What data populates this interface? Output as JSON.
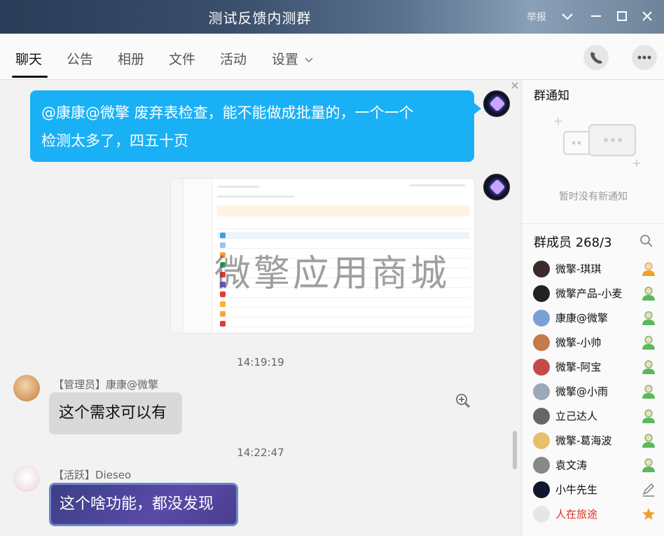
{
  "window": {
    "title": "测试反馈内测群",
    "report_label": "举报"
  },
  "tabs": [
    {
      "label": "聊天",
      "active": true
    },
    {
      "label": "公告"
    },
    {
      "label": "相册"
    },
    {
      "label": "文件"
    },
    {
      "label": "活动"
    },
    {
      "label": "设置"
    }
  ],
  "chat": {
    "messages": [
      {
        "type": "self_text",
        "text_line1": "@康康@微擎 废弃表检查，能不能做成批量的，一个一个",
        "text_line2": "检测太多了，四五十页"
      },
      {
        "type": "self_image",
        "watermark": "微擎应用商城"
      },
      {
        "type": "time",
        "text": "14:19:19"
      },
      {
        "type": "other_text",
        "sender": "【管理员】康康@微擎",
        "text": "这个需求可以有"
      },
      {
        "type": "time",
        "text": "14:22:47"
      },
      {
        "type": "other_text",
        "sender": "【活跃】Dieseo",
        "text": "这个啥功能，都没发现"
      }
    ]
  },
  "side": {
    "notice_title": "群通知",
    "notice_empty": "暂时没有新通知",
    "members_title": "群成员 268/3",
    "members": [
      {
        "name": "微擎-琪琪",
        "role": "admin"
      },
      {
        "name": "微擎产品-小麦",
        "role": "member"
      },
      {
        "name": "康康@微擎",
        "role": "member"
      },
      {
        "name": "微擎-小帅",
        "role": "member"
      },
      {
        "name": "微擎-阿宝",
        "role": "member"
      },
      {
        "name": "微擎@小雨",
        "role": "member"
      },
      {
        "name": "立己达人",
        "role": "member"
      },
      {
        "name": "微擎-葛海波",
        "role": "member"
      },
      {
        "name": "袁文涛",
        "role": "member"
      },
      {
        "name": "小牛先生",
        "role": "self"
      },
      {
        "name": "人在旅途",
        "role": "owner"
      }
    ]
  },
  "colors": {
    "accent": "#1ab0f5",
    "member_role_green": "#5cb85c",
    "member_role_orange": "#f0a030",
    "owner_red": "#e0301e"
  }
}
